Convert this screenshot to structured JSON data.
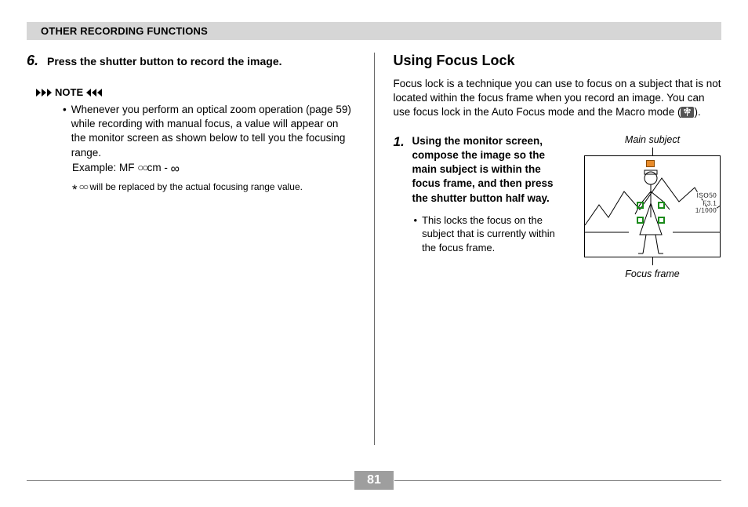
{
  "header": {
    "title": "OTHER RECORDING FUNCTIONS"
  },
  "left": {
    "step6_num": "6.",
    "step6_text": "Press the shutter button to record the image.",
    "note_label": "NOTE",
    "note_bullet": "Whenever you perform an optical zoom operation (page 59) while recording with manual focus, a value will appear on the monitor screen as shown below to tell you the focusing range.",
    "example_prefix": "Example: MF ",
    "example_circles": "○○",
    "example_mid": "cm - ",
    "example_infinity": "∞",
    "asterisk_circles": "○○",
    "asterisk_text": " will be replaced by the actual focusing range value."
  },
  "right": {
    "title": "Using Focus Lock",
    "intro_a": "Focus lock is a technique you can use to focus on a subject that is not located within the focus frame when you record an image. You can use focus lock in the Auto Focus mode and the Macro mode (",
    "intro_b": ").",
    "step1_num": "1.",
    "step1_text": "Using the monitor screen, compose the image so the main subject is within the focus frame, and then press the shutter button half way.",
    "step1_bullet": "This locks the focus on the subject that is currently within the focus frame.",
    "fig_main": "Main subject",
    "fig_focus": "Focus frame",
    "iso1": "ISO50",
    "iso2": "F3.1",
    "iso3": "1/1000"
  },
  "page_number": "81"
}
